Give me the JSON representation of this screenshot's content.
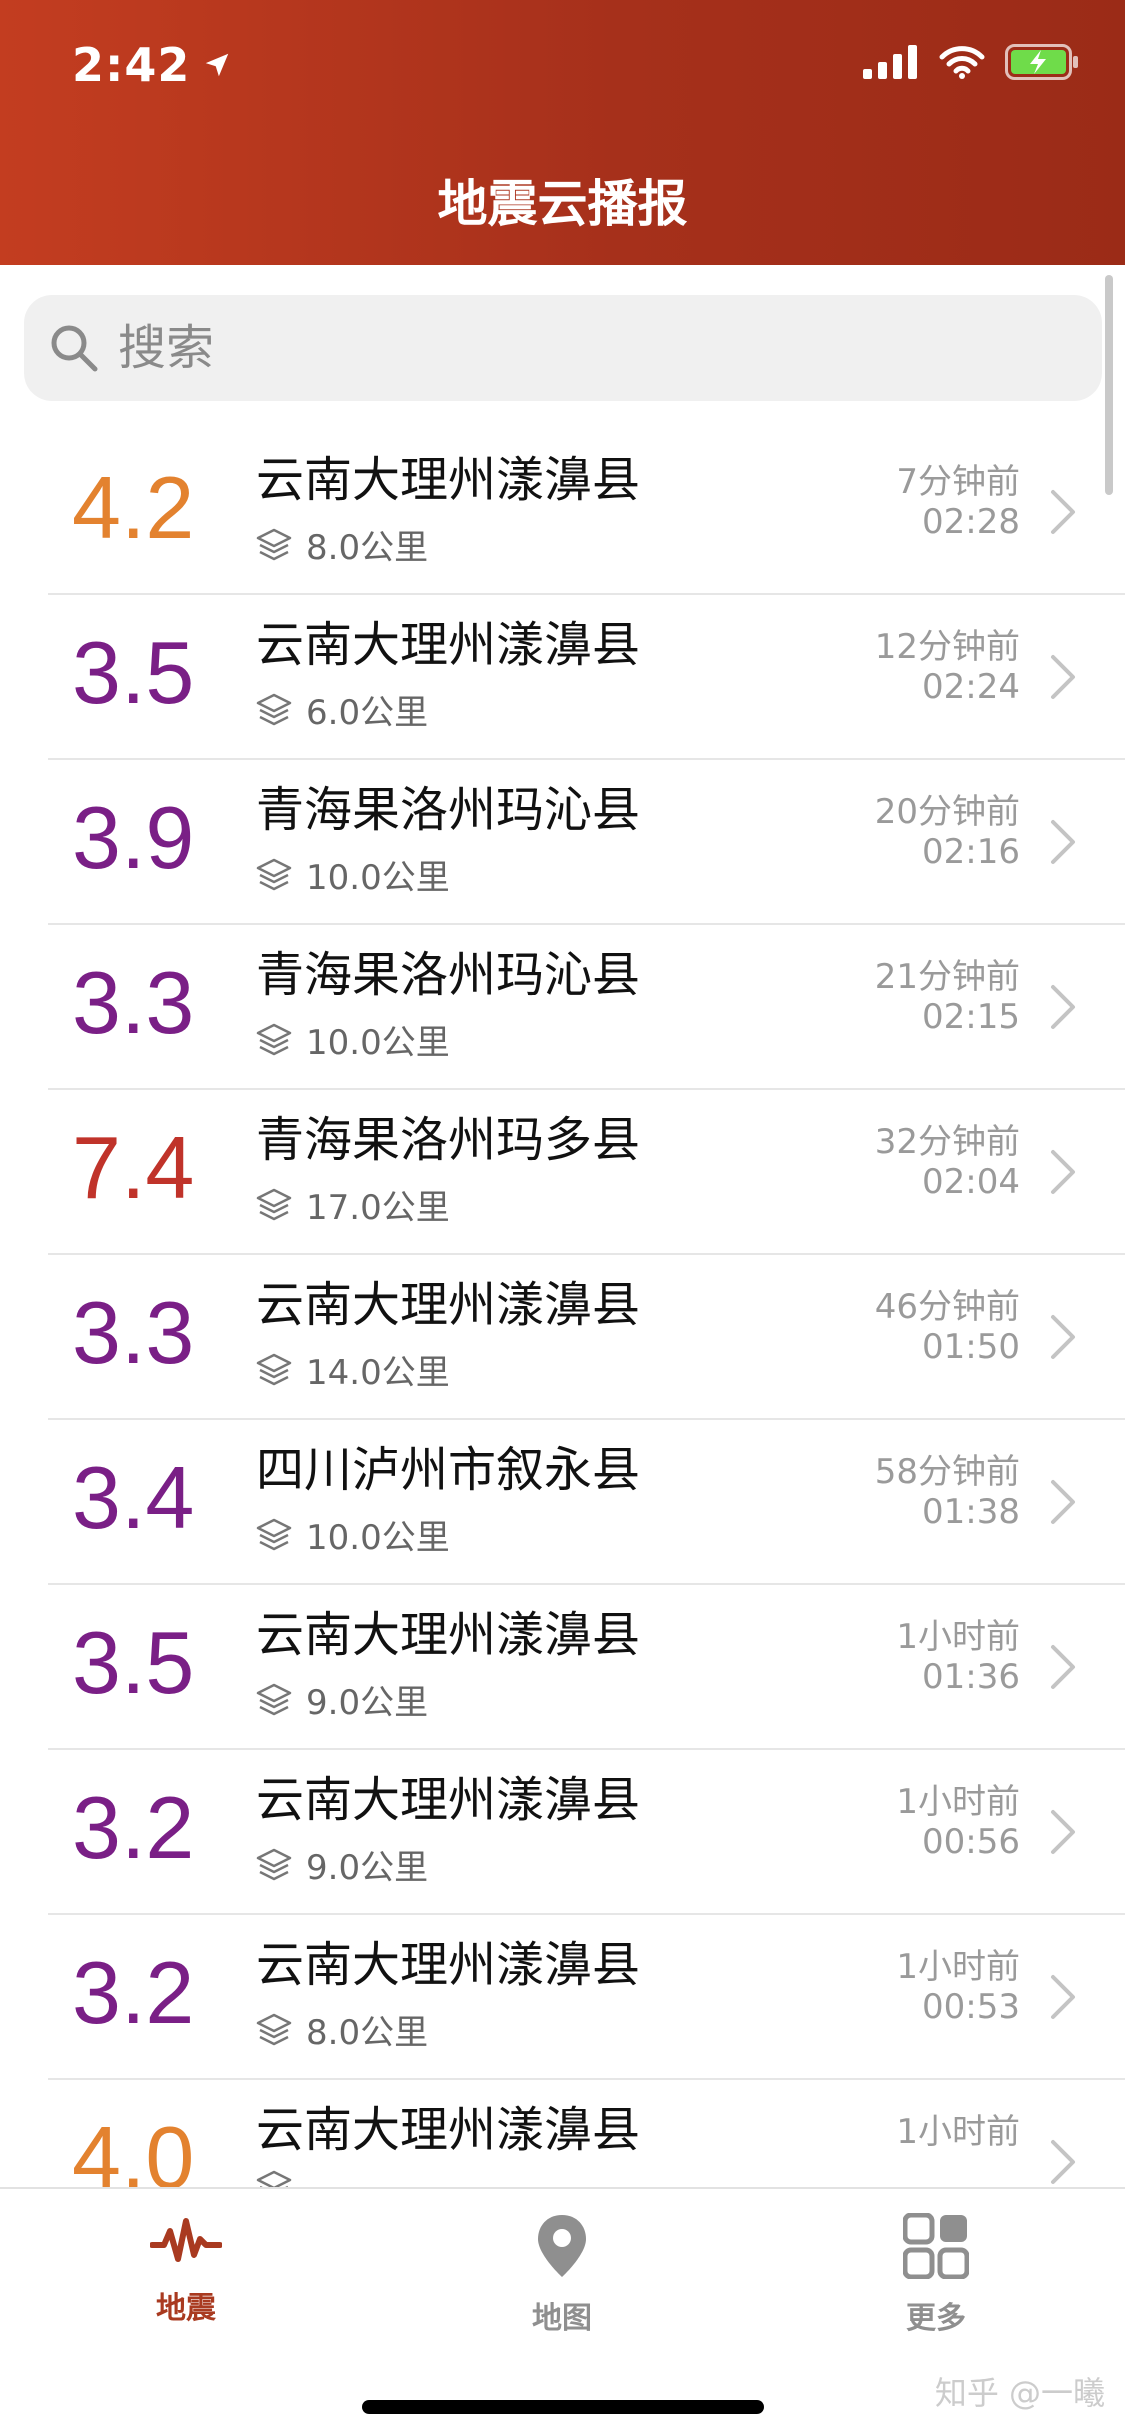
{
  "status_bar": {
    "time": "2:42"
  },
  "header": {
    "title": "地震云播报"
  },
  "search": {
    "placeholder": "搜索"
  },
  "colors": {
    "header": "#b3361d",
    "mag_orange": "#e3822f",
    "mag_purple": "#7a1f86",
    "mag_red": "#c0332a",
    "tab_active": "#a93a20",
    "tab_inactive": "#8f8f8f"
  },
  "quakes": [
    {
      "magnitude": "4.2",
      "place": "云南大理州漾濞县",
      "depth": "8.0公里",
      "ago": "7分钟前",
      "time": "02:28",
      "color": "#e3822f"
    },
    {
      "magnitude": "3.5",
      "place": "云南大理州漾濞县",
      "depth": "6.0公里",
      "ago": "12分钟前",
      "time": "02:24",
      "color": "#7a1f86"
    },
    {
      "magnitude": "3.9",
      "place": "青海果洛州玛沁县",
      "depth": "10.0公里",
      "ago": "20分钟前",
      "time": "02:16",
      "color": "#7a1f86"
    },
    {
      "magnitude": "3.3",
      "place": "青海果洛州玛沁县",
      "depth": "10.0公里",
      "ago": "21分钟前",
      "time": "02:15",
      "color": "#7a1f86"
    },
    {
      "magnitude": "7.4",
      "place": "青海果洛州玛多县",
      "depth": "17.0公里",
      "ago": "32分钟前",
      "time": "02:04",
      "color": "#c0332a"
    },
    {
      "magnitude": "3.3",
      "place": "云南大理州漾濞县",
      "depth": "14.0公里",
      "ago": "46分钟前",
      "time": "01:50",
      "color": "#7a1f86"
    },
    {
      "magnitude": "3.4",
      "place": "四川泸州市叙永县",
      "depth": "10.0公里",
      "ago": "58分钟前",
      "time": "01:38",
      "color": "#7a1f86"
    },
    {
      "magnitude": "3.5",
      "place": "云南大理州漾濞县",
      "depth": "9.0公里",
      "ago": "1小时前",
      "time": "01:36",
      "color": "#7a1f86"
    },
    {
      "magnitude": "3.2",
      "place": "云南大理州漾濞县",
      "depth": "9.0公里",
      "ago": "1小时前",
      "time": "00:56",
      "color": "#7a1f86"
    },
    {
      "magnitude": "3.2",
      "place": "云南大理州漾濞县",
      "depth": "8.0公里",
      "ago": "1小时前",
      "time": "00:53",
      "color": "#7a1f86"
    },
    {
      "magnitude": "4.0",
      "place": "云南大理州漾濞县",
      "depth": "",
      "ago": "1小时前",
      "time": "",
      "color": "#e3822f"
    }
  ],
  "tabs": [
    {
      "label": "地震",
      "icon": "seismic-wave-icon",
      "active": true
    },
    {
      "label": "地图",
      "icon": "map-pin-icon",
      "active": false
    },
    {
      "label": "更多",
      "icon": "grid-icon",
      "active": false
    }
  ],
  "watermark": "知乎 @一曦"
}
